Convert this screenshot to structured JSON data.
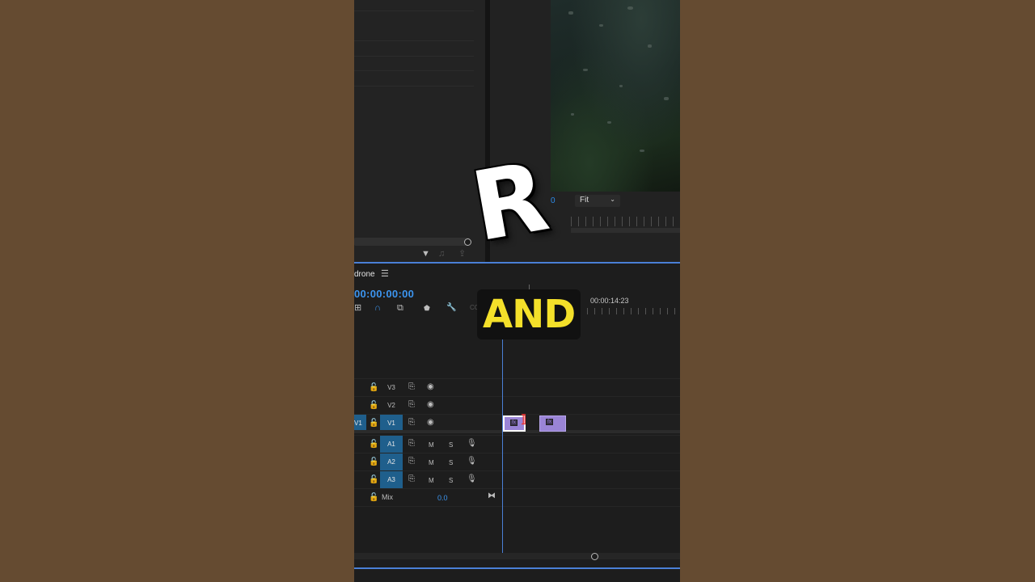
{
  "project_panel": {
    "tools": [
      {
        "icon": "filter-icon",
        "glyph": "▼"
      },
      {
        "icon": "music-icon",
        "glyph": "♫"
      },
      {
        "icon": "export-icon",
        "glyph": "⇪"
      }
    ]
  },
  "program_monitor": {
    "zoom_value_partial": "0",
    "fit_label": "Fit"
  },
  "timeline": {
    "sequence_name": "drone",
    "menu_glyph": "☰",
    "timecode": "00:00:00:00",
    "ruler_time": "00:00:14:23",
    "tools": [
      {
        "icon": "ripple-edit-icon",
        "glyph": "⊞",
        "active": false
      },
      {
        "icon": "snap-magnet-icon",
        "glyph": "∩",
        "active": true
      },
      {
        "icon": "linked-selection-icon",
        "glyph": "⧉",
        "active": false
      },
      {
        "icon": "add-marker-icon",
        "glyph": "⬟",
        "active": false
      },
      {
        "icon": "wrench-settings-icon",
        "glyph": "🔧",
        "active": false
      },
      {
        "icon": "captions-icon",
        "glyph": "CC",
        "active": false
      }
    ],
    "video_tracks": [
      {
        "name": "V3",
        "targeted": false,
        "source_patch": ""
      },
      {
        "name": "V2",
        "targeted": false,
        "source_patch": ""
      },
      {
        "name": "V1",
        "targeted": true,
        "source_patch": "V1"
      }
    ],
    "audio_tracks": [
      {
        "name": "A1",
        "mute": "M",
        "solo": "S"
      },
      {
        "name": "A2",
        "mute": "M",
        "solo": "S"
      },
      {
        "name": "A3",
        "mute": "M",
        "solo": "S"
      }
    ],
    "mix": {
      "label": "Mix",
      "value": "0.0"
    },
    "clip_label": "fx"
  },
  "overlay_captions": {
    "big_letter": "R",
    "word": "AND"
  },
  "colors": {
    "accent_blue": "#3c95f0",
    "clip_purple": "#9a84d6",
    "caption_yellow": "#f4e02a",
    "background_brown": "#654b31"
  }
}
